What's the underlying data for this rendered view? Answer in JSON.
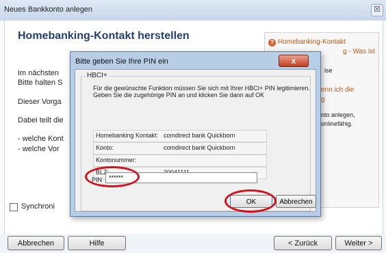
{
  "window": {
    "title": "Neues Bankkonto anlegen",
    "close_glyph": "☒"
  },
  "main": {
    "heading": "Homebanking-Kontakt herstellen",
    "lines": [
      "Im nächsten",
      "Bitte halten S",
      "Dieser Vorga",
      "Dabei teilt die",
      "- welche Kont",
      "- welche Vor"
    ],
    "checkbox_label": "Synchroni"
  },
  "sidebox": {
    "title_line1": "Homebanking-Kontakt",
    "title_line2": "g - Was ist",
    "text1": "ise",
    "text2": "enn ich die",
    "text3": "g",
    "text4": "nto anlegen,",
    "text5": "onlinefähig."
  },
  "footer": {
    "cancel": "Abbrechen",
    "help": "Hilfe",
    "back": "< Zurück",
    "next": "Weiter >"
  },
  "dialog": {
    "title": "Bitte geben Sie Ihre PIN ein",
    "close": "x",
    "group_label": "HBCI+",
    "instruction_line1": "Für die gewünschte Funktion müssen Sie sich mit Ihrer HBCI+ PIN legitimieren.",
    "instruction_line2": "Geben Sie die zugehörige PIN an und klicken Sie dann auf OK",
    "rows": [
      {
        "label": "Homebanking Kontakt:",
        "value": "comdirect bank Quickborn"
      },
      {
        "label": "Konto:",
        "value": "comdirect bank Quickborn"
      },
      {
        "label": "Kontonummer:",
        "value": ""
      },
      {
        "label": "BLZ:",
        "value": "20041111"
      }
    ],
    "pin_label": "PIN",
    "pin_value": "******",
    "ok": "OK",
    "cancel": "Abbrechen"
  },
  "colors": {
    "heading": "#233e72",
    "accent_orange": "#c8580d",
    "annotation_red": "#d0141c"
  }
}
